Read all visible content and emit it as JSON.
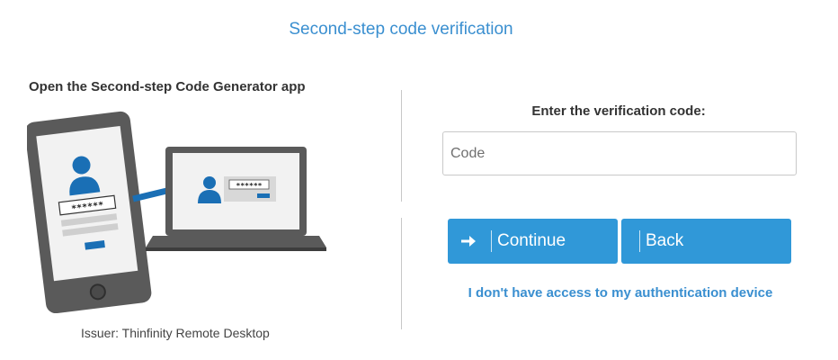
{
  "page": {
    "title": "Second-step code verification"
  },
  "left": {
    "heading": "Open the Second-step Code Generator app",
    "issuer": "Issuer: Thinfinity Remote Desktop",
    "phone_password_mask": "******",
    "laptop_password_mask": "******"
  },
  "right": {
    "code_label": "Enter the verification code:",
    "code_input": {
      "value": "",
      "placeholder": "Code"
    },
    "continue_label": "Continue",
    "back_label": "Back",
    "no_access_link": "I don't have access to my authentication device"
  },
  "colors": {
    "accent": "#3098d8",
    "link": "#3a8fd0",
    "device_body": "#5a5a5a",
    "device_icon_blue": "#1a6fb5"
  },
  "icons": {
    "continue": "arrow-right-icon",
    "phone": "smartphone-icon",
    "laptop": "laptop-icon",
    "user": "user-icon",
    "transfer": "arrow-right-icon"
  }
}
